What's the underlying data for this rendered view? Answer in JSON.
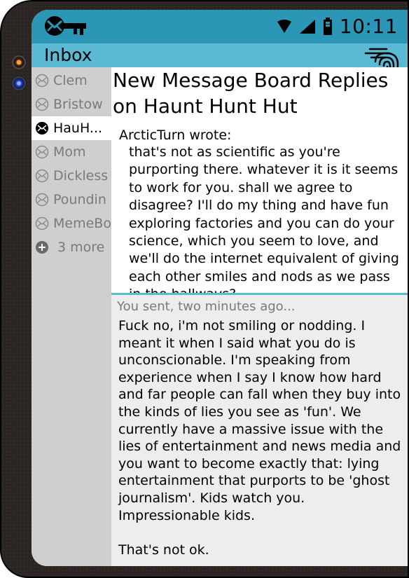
{
  "status_bar": {
    "time": "10:11",
    "icons": [
      "mail-key-logo-icon",
      "wifi-icon",
      "signal-icon",
      "battery-icon"
    ]
  },
  "header": {
    "title": "Inbox",
    "fingerprint_icon": "fingerprint-icon"
  },
  "sidebar": {
    "items": [
      {
        "label": "Clem",
        "icon": "envelope-icon",
        "active": false
      },
      {
        "label": "Bristow",
        "icon": "envelope-icon",
        "active": false
      },
      {
        "label": "HauH...",
        "icon": "envelope-icon",
        "active": true
      },
      {
        "label": "Mom",
        "icon": "envelope-icon",
        "active": false
      },
      {
        "label": "Dickless",
        "icon": "envelope-icon",
        "active": false
      },
      {
        "label": "Poundin",
        "icon": "envelope-icon",
        "active": false
      },
      {
        "label": "MemeBo",
        "icon": "envelope-icon",
        "active": false
      }
    ],
    "more_label": "3 more"
  },
  "message": {
    "subject": "New Message Board Replies on Haunt Hunt Hut",
    "quote_author": "ArcticTurn wrote:",
    "quote_text": "that's not as scientific as you're purporting there. whatever it is it seems to work for you. shall we agree to disagree? I'll do my thing and have fun  exploring factories and you can do your science, which you seem to love, and we'll do the internet equivalent of giving each other smiles and nods as we pass in the hallways?"
  },
  "reply": {
    "meta": "You sent, two minutes ago...",
    "text": "Fuck no, i'm not smiling or nodding.  I meant it when I said what you do is unconscionable.  I'm speaking from experience when I say I know how hard and far people can fall when they buy into the kinds of lies you see as 'fun'.  We currently have a massive issue with the lies of entertainment and news media and you want to become exactly that: lying entertainment that purports to be 'ghost journalism'.  Kids watch you.  Impressionable kids.\n\nThat's not ok."
  },
  "colors": {
    "status_bar": "#2b96b6",
    "title_bar": "#5bb9d3",
    "sidebar": "#cfcfcf",
    "reply_bg": "#ededed",
    "inactive_text": "#7a7a7a"
  }
}
